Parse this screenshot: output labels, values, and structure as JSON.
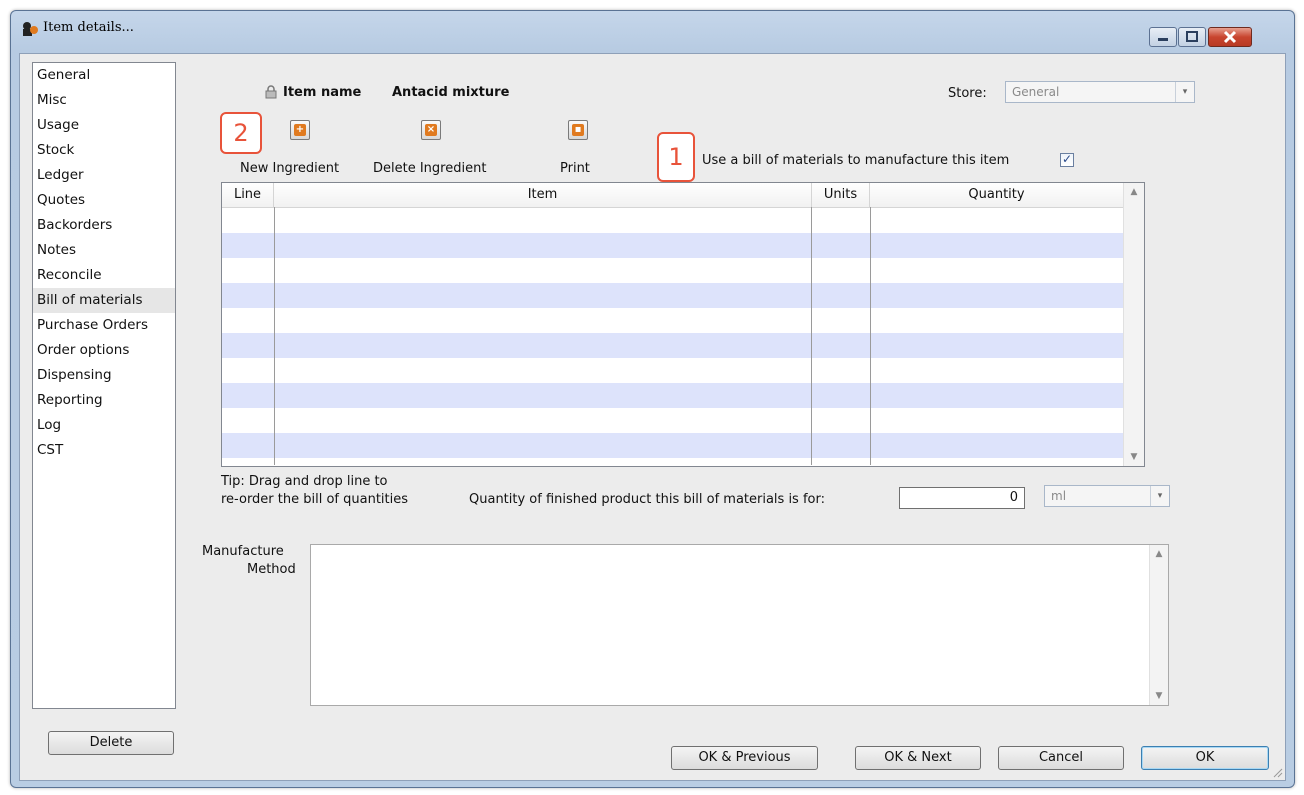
{
  "window": {
    "title": "Item details...",
    "controls": {
      "minimize": "minimize-icon",
      "maximize": "maximize-icon",
      "close": "close-icon"
    }
  },
  "sidebar": {
    "items": [
      {
        "label": "General"
      },
      {
        "label": "Misc"
      },
      {
        "label": "Usage"
      },
      {
        "label": "Stock"
      },
      {
        "label": "Ledger"
      },
      {
        "label": "Quotes"
      },
      {
        "label": "Backorders"
      },
      {
        "label": "Notes"
      },
      {
        "label": "Reconcile"
      },
      {
        "label": "Bill of materials",
        "active": true
      },
      {
        "label": "Purchase Orders"
      },
      {
        "label": "Order options"
      },
      {
        "label": "Dispensing"
      },
      {
        "label": "Reporting"
      },
      {
        "label": "Log"
      },
      {
        "label": "CST"
      }
    ],
    "delete_label": "Delete"
  },
  "header": {
    "item_name_label": "Item name",
    "item_name_value": "Antacid mixture",
    "store_label": "Store:",
    "store_value": "General"
  },
  "toolbar": {
    "new_ingredient": "New Ingredient",
    "delete_ingredient": "Delete Ingredient",
    "print": "Print"
  },
  "callouts": {
    "one": "1",
    "two": "2"
  },
  "bom_checkbox": {
    "label": "Use a bill of materials to manufacture this item",
    "checked": true,
    "mark": "✓"
  },
  "table": {
    "columns": [
      "Line",
      "Item",
      "Units",
      "Quantity"
    ],
    "rows": []
  },
  "tip": {
    "line1": "Tip: Drag and drop line to",
    "line2": "re-order the bill of quantities"
  },
  "quantity": {
    "label": "Quantity of finished product this bill of materials is for:",
    "value": "0",
    "unit": "ml"
  },
  "manufacture": {
    "label_line1": "Manufacture",
    "label_line2": "Method",
    "value": ""
  },
  "buttons": {
    "ok_previous": "OK & Previous",
    "ok_next": "OK & Next",
    "cancel": "Cancel",
    "ok": "OK"
  },
  "colors": {
    "accent": "#e8533a",
    "row_alt": "#dde3fb",
    "title_bg": "#b9cde3"
  }
}
